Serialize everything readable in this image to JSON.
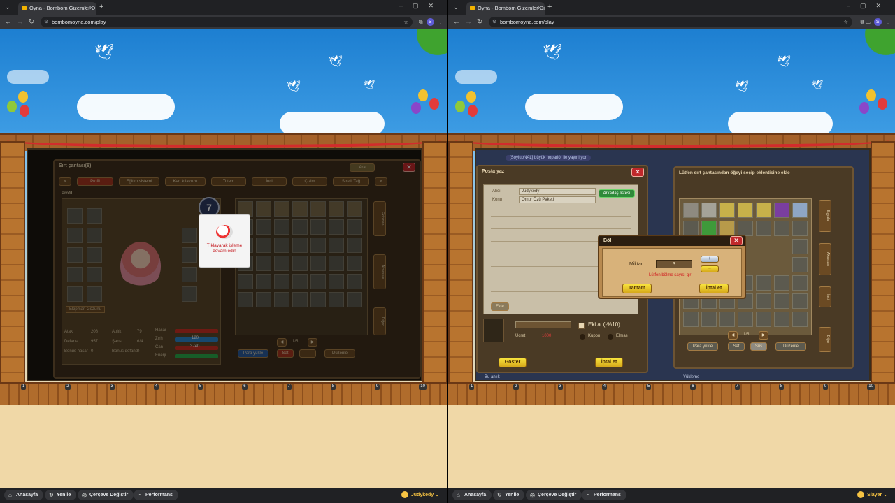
{
  "left": {
    "tab_title": "Oyna - Bombom Gizemler D",
    "url": "bombomoyna.com/play",
    "bag_title": "Sırt çantası(8)",
    "search_btn": "Ara",
    "tabs": [
      "Profil",
      "Eğitim sistemi",
      "Kart kılavuzu",
      "Totem",
      "İnci",
      "Çizim",
      "Strelli Tağ"
    ],
    "profile_label": "Profil",
    "equipment_label": "Ekipman Gözünü",
    "level": "7",
    "stats": [
      {
        "k": "Atak",
        "v": "208"
      },
      {
        "k": "Defans",
        "v": "957"
      },
      {
        "k": "Bonus hasar",
        "v": "0"
      }
    ],
    "stats2": [
      {
        "k": "Atılık",
        "v": "79"
      },
      {
        "k": "Şans",
        "v": "6/4"
      },
      {
        "k": "Bonus defans",
        "v": "0"
      }
    ],
    "bars": [
      {
        "k": "Hasar",
        "color": "#c93124"
      },
      {
        "k": "Zırh",
        "color": "#2a84c9"
      },
      {
        "k": "Can",
        "color": "#c93124"
      },
      {
        "k": "Enerji",
        "color": "#2aa84a"
      }
    ],
    "bar_vals": [
      "",
      "120",
      "3740",
      ""
    ],
    "page": "1/5",
    "buttons": [
      "Para yükle",
      "Sat",
      "",
      "Düzenle"
    ],
    "pause_text_1": "Tıklayarak işleme",
    "pause_text_2": "devam edin",
    "side_tabs": [
      "Ekipman",
      "Aksesuar",
      "Diğer"
    ]
  },
  "right": {
    "tab_title": "Oyna - Bombom Gizemler Diya",
    "url": "bombomoyna.com/play",
    "marquee": "[SoylubNAL] büyük hoparlör ile yayınlıyor",
    "mail_title": "Posta yaz",
    "alici_label": "Alıcı",
    "alici_value": "Judykedy",
    "konu_label": "Konu",
    "konu_value": "Omur Özü Paketi",
    "friends_btn": "Arkadaş listesi",
    "ekle_btn": "Ekle",
    "ucret_label": "Ücret",
    "ucret_value": "1000",
    "attach_label": "Eki al (-%10)",
    "kupon_label": "Kupon",
    "elmas_label": "Elmas",
    "cancel_btn": "Göster",
    "send_btn": "İptal et",
    "bag_title": "Lütfen sırt çantasından öğeyi seçip eklentisine ekle",
    "page": "1/5",
    "bag_buttons": [
      "Para yükle",
      "Sat",
      "Süs",
      "Düzenle"
    ],
    "side_tabs": [
      "Eşyalar",
      "Aksesuar",
      "İnci",
      "Diğer"
    ],
    "chat_placeholder": "Bu anlık",
    "loading": "Yükleme",
    "dialog": {
      "title": "Böl",
      "amount_label": "Miktar",
      "amount_value": "3",
      "error": "Lütfen bölme sayısı gir",
      "ok": "Tamam",
      "cancel": "İptal et"
    }
  },
  "bottombar": {
    "home": "Anasayfa",
    "refresh": "Yenile",
    "frame": "Çerçeve Değiştir",
    "perf": "Performans"
  },
  "users": {
    "left": "Judykedy",
    "right": "Slayer"
  },
  "slot_numbers": [
    "1",
    "2",
    "3",
    "4",
    "5",
    "6",
    "7",
    "8",
    "9",
    "10"
  ],
  "colors": {
    "chrome_dark": "#202124",
    "chrome_mid": "#35363a",
    "sky": "#3c9be3",
    "sand": "#f0d8a7",
    "error_red": "#d0141b",
    "accent_gold": "#f6c343"
  }
}
